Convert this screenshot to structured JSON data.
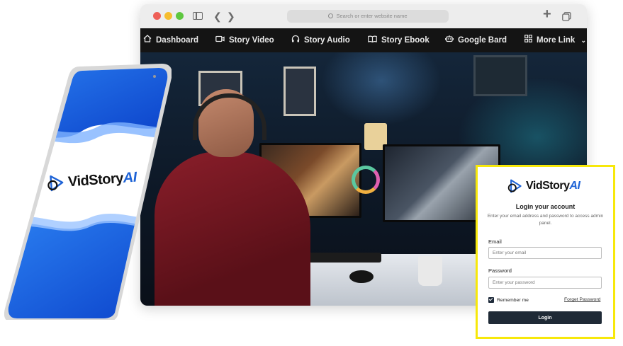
{
  "browser": {
    "address_placeholder": "Search or enter website name",
    "plus_icon": "+",
    "tabs_icon": "tabs-overview-icon"
  },
  "nav": {
    "items": [
      {
        "label": "Dashboard",
        "icon": "home-icon"
      },
      {
        "label": "Story Video",
        "icon": "video-camera-icon"
      },
      {
        "label": "Story Audio",
        "icon": "headphones-icon"
      },
      {
        "label": "Story Ebook",
        "icon": "book-icon"
      },
      {
        "label": "Google Bard",
        "icon": "robot-icon"
      },
      {
        "label": "More Link",
        "icon": "grid-icon"
      }
    ]
  },
  "brand": {
    "name": "VidStory",
    "suffix": "AI",
    "accent": "#1e63d6"
  },
  "login": {
    "title": "Login your account",
    "subtitle": "Enter your email address and password to access admin panel.",
    "email_label": "Email",
    "email_placeholder": "Enter your email",
    "password_label": "Password",
    "password_placeholder": "Enter your password",
    "remember_label": "Remember me",
    "forget_label": "Forget Password",
    "button_label": "Login",
    "border_color": "#f7e80a"
  }
}
